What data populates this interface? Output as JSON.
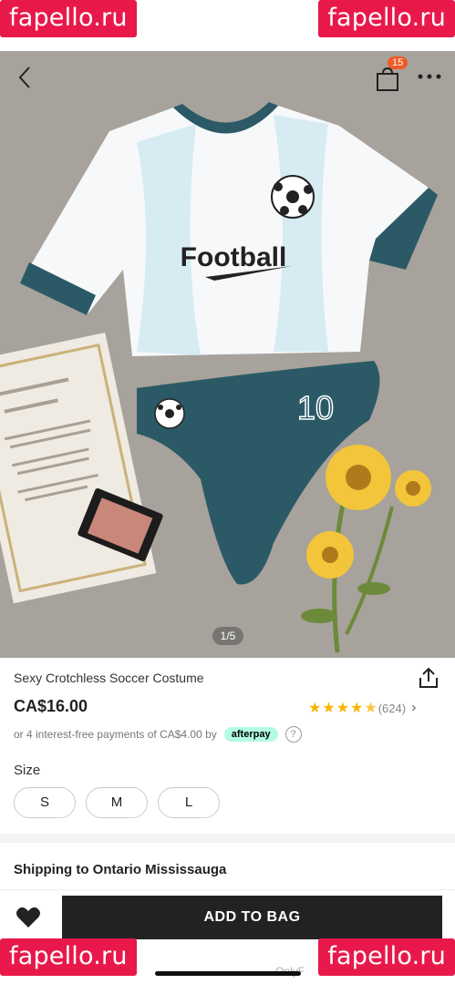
{
  "watermark": "fapello.ru",
  "header": {
    "back_icon": "chevron-left-icon",
    "bag_icon": "shopping-bag-icon",
    "bag_count": "15",
    "more_icon": "more-dots-icon"
  },
  "gallery": {
    "pager": "1/5",
    "shirt_text": "Football",
    "number_text": "10"
  },
  "product": {
    "title": "Sexy Crotchless Soccer Costume",
    "price": "CA$16.00",
    "rating_stars": 4.5,
    "review_count": "(624)",
    "installments": "or 4 interest-free payments of CA$4.00 by",
    "afterpay_label": "afterpay",
    "help": "?"
  },
  "size": {
    "label": "Size",
    "options": [
      "S",
      "M",
      "L"
    ]
  },
  "shipping": {
    "label": "Shipping to Ontario Mississauga"
  },
  "actions": {
    "wishlist_icon": "heart-icon",
    "add_to_bag": "ADD TO BAG"
  },
  "footer_text": "OnlyF",
  "colors": {
    "accent": "#222222",
    "star": "#f7b500",
    "badge": "#f05a28",
    "afterpay": "#b2fce4",
    "watermark": "#e8194a",
    "jersey_teal": "#2b5a66"
  }
}
